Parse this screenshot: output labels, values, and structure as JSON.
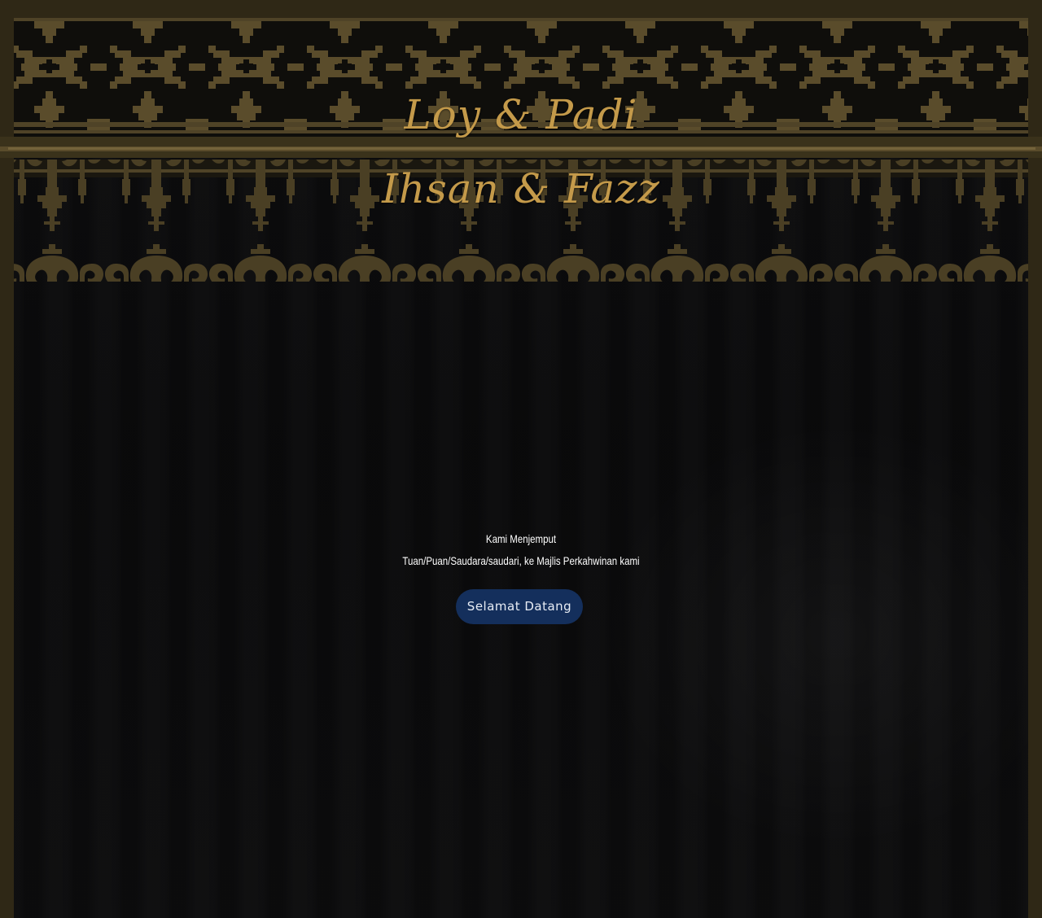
{
  "hero": {
    "names_primary": "Loy & Padi",
    "names_secondary": "Ihsan & Fazz"
  },
  "invitation": {
    "line1": "Kami Menjemput",
    "line2": "Tuan/Puan/Saudara/saudari, ke Majlis Perkahwinan kami"
  },
  "actions": {
    "welcome_label": "Selamat Datang"
  },
  "colors": {
    "gold": "#c49a4a",
    "pattern_gold": "#4f4327",
    "border": "#2f2816",
    "background": "#0b0b0c",
    "button": "#142f5c"
  },
  "decor": {
    "top_pattern": "songket-border-icon"
  }
}
